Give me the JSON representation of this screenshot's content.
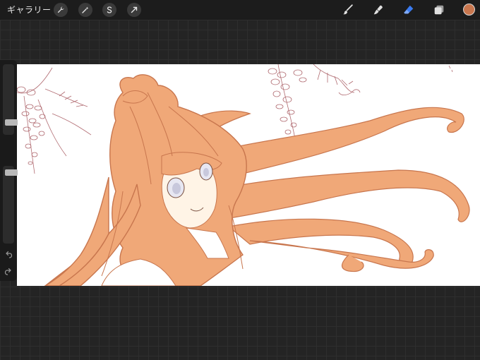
{
  "topbar": {
    "gallery_label": "ギャラリー",
    "left_tools": [
      {
        "icon": "wrench-icon"
      },
      {
        "icon": "magic-wand-icon"
      },
      {
        "icon": "selection-s-icon"
      },
      {
        "icon": "transform-arrow-icon"
      }
    ],
    "right_tools": [
      {
        "icon": "brush-icon"
      },
      {
        "icon": "smudge-icon"
      },
      {
        "icon": "eraser-icon",
        "active": true
      },
      {
        "icon": "layers-icon"
      }
    ],
    "current_color": "#c8764e",
    "active_tool_color": "#3a7bf0"
  },
  "sidebar": {
    "brush_size_level": 0.14,
    "opacity_level": 0.95,
    "modify_icon": "square-icon",
    "undo_icon": "undo-arrow-icon",
    "redo_icon": "redo-arrow-icon"
  },
  "canvas": {
    "content": "illustration",
    "hair_color": "#f0a878",
    "hair_line_color": "#c8764e",
    "wisteria_line_color": "#b06a70"
  }
}
